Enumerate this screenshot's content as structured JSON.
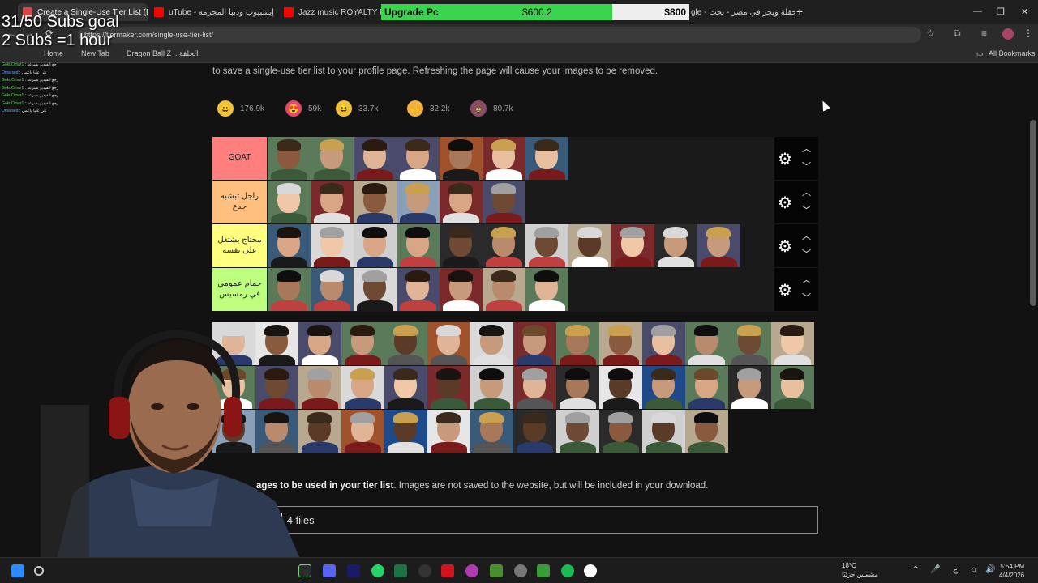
{
  "browser": {
    "tabs": [
      {
        "title": "Create a Single-Use Tier List (P",
        "favicon": "tiermaker-icon"
      },
      {
        "title": "uTube - إيستيوب وديبا المجرمه",
        "favicon": "youtube-icon"
      },
      {
        "title": "Jazz music ROYALTY FREE Bac",
        "favicon": "youtube-icon"
      },
      {
        "title": "gle - حفلة ويجز في مصر - بحث",
        "favicon": "google-icon"
      }
    ],
    "url": "https://tiermaker.com/single-use-tier-list/",
    "bookmarks": [
      "Home",
      "New Tab",
      "Dragon Ball Z ...الحلقة"
    ],
    "all_bookmarks": "All Bookmarks"
  },
  "overlay": {
    "subs_goal": "31/50 Subs goal\n2 Subs =1 hour",
    "chat": [
      {
        "user": "GokuOmar1",
        "text": "رجع الفيديو بسرعه"
      },
      {
        "user": "Omarsed",
        "text": "تلي عليا ياعمي"
      },
      {
        "user": "GokuOmar1",
        "text": "رجع الفيديو بسرعه"
      },
      {
        "user": "GokuOmar1",
        "text": "رجع الفيديو بسرعه"
      },
      {
        "user": "GokuOmar1",
        "text": "رجع الفيديو بسرعه"
      },
      {
        "user": "GokuOmar1",
        "text": "رجع الفيديو بسرعه"
      },
      {
        "user": "Omarsed",
        "text": "تلي عليا ياعمي"
      }
    ],
    "upgrade": {
      "label": "Upgrade Pc",
      "current": "$600.2",
      "goal": "$800",
      "progress": 0.75
    }
  },
  "page": {
    "intro": "to save a single-use tier list to your profile page. Refreshing the page will cause your images to be removed.",
    "reactions": [
      {
        "icon": "grin-emoji-icon",
        "glyph": "😀",
        "count": "176.9k",
        "color": "#f2c23c"
      },
      {
        "icon": "heart-eyes-emoji-icon",
        "glyph": "😍",
        "count": "59k",
        "color": "#e8456c"
      },
      {
        "icon": "laughing-emoji-icon",
        "glyph": "😆",
        "count": "33.7k",
        "color": "#f2c23c"
      },
      {
        "icon": "raised-hands-emoji-icon",
        "glyph": "🙌",
        "count": "32.2k",
        "color": "#f2b43c"
      },
      {
        "icon": "poop-emoji-icon",
        "glyph": "💩",
        "count": "80.7k",
        "color": "#8a4b6a"
      }
    ],
    "tiers": [
      {
        "label": "GOAT",
        "color": "#ff7f7f",
        "items": 7
      },
      {
        "label": "راجل تبشبه جدع",
        "color": "#ffbf7f",
        "items": 6
      },
      {
        "label": "محتاج يشتغل على نفسه",
        "color": "#ffff7f",
        "items": 11
      },
      {
        "label": "حمام عمومي في رمسيس",
        "color": "#bfff7f",
        "items": 7
      }
    ],
    "pool_count": 40,
    "upload_prefix": "ages to be used in your tier list",
    "upload_suffix": ". Images are not saved to the website, but will be included in your download.",
    "file_button": "es",
    "file_count": "4 files"
  },
  "taskbar": {
    "weather_temp": "18°C",
    "weather_desc": "مشمس جزئيًا",
    "time": "5:54 PM",
    "date": "4/4/2026",
    "lang": "ع"
  }
}
